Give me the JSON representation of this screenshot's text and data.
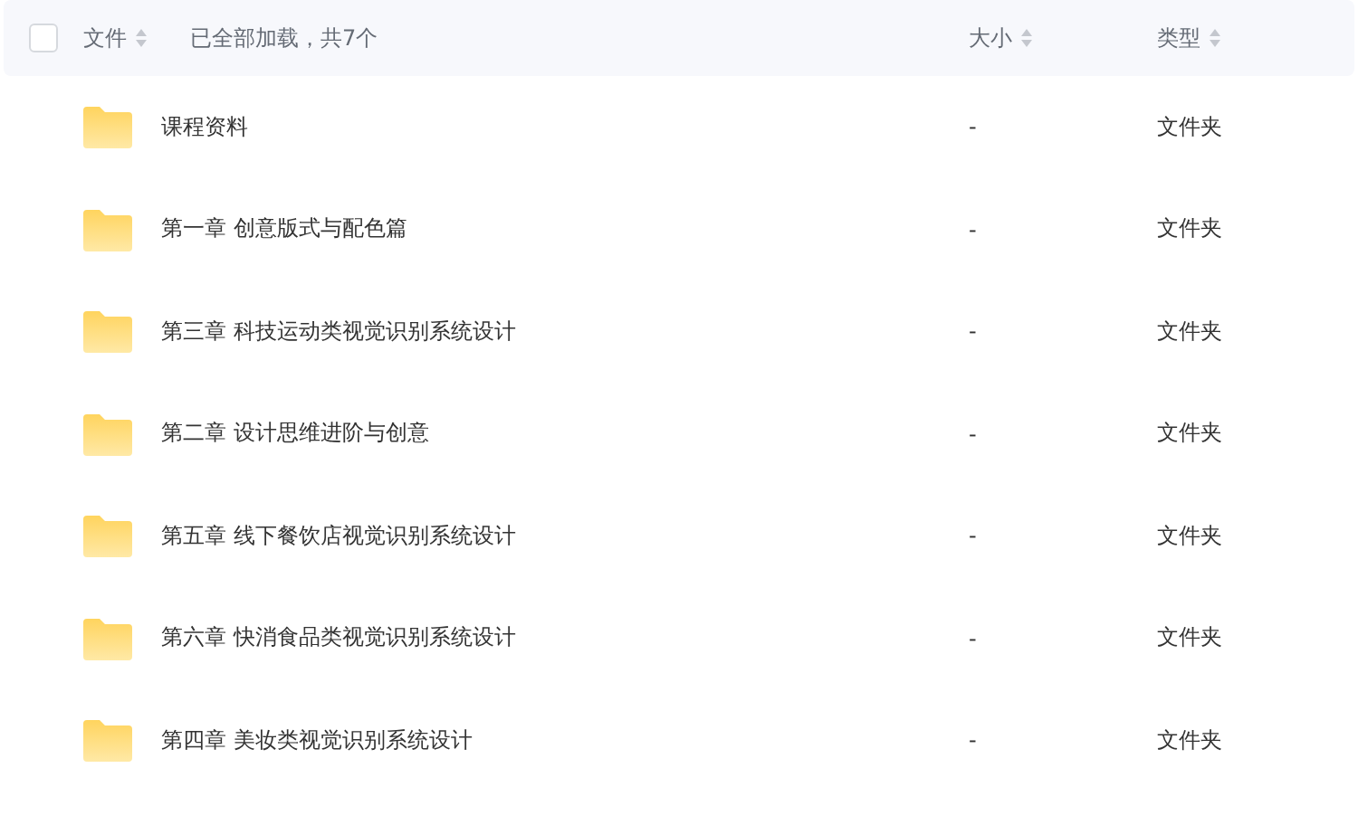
{
  "header": {
    "select_all": {
      "checked": false
    },
    "columns": [
      {
        "label": "文件"
      },
      {
        "label": "大小"
      },
      {
        "label": "类型"
      }
    ],
    "status": "已全部加载，共7个"
  },
  "rows": [
    {
      "name": "课程资料",
      "size": "-",
      "type": "文件夹"
    },
    {
      "name": "第一章 创意版式与配色篇",
      "size": "-",
      "type": "文件夹"
    },
    {
      "name": "第三章 科技运动类视觉识别系统设计",
      "size": "-",
      "type": "文件夹"
    },
    {
      "name": "第二章 设计思维进阶与创意",
      "size": "-",
      "type": "文件夹"
    },
    {
      "name": "第五章 线下餐饮店视觉识别系统设计",
      "size": "-",
      "type": "文件夹"
    },
    {
      "name": "第六章 快消食品类视觉识别系统设计",
      "size": "-",
      "type": "文件夹"
    },
    {
      "name": "第四章 美妆类视觉识别系统设计",
      "size": "-",
      "type": "文件夹"
    }
  ]
}
